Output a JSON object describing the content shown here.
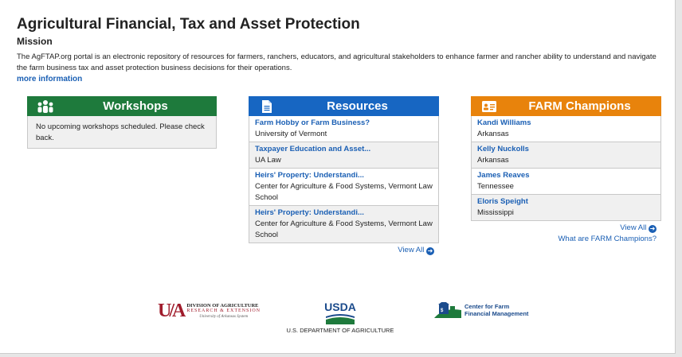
{
  "page": {
    "title": "Agricultural Financial, Tax and Asset Protection",
    "mission_heading": "Mission",
    "description": "The AgFTAP.org portal is an electronic repository of resources for farmers, ranchers, educators, and agricultural stakeholders to enhance farmer and rancher ability to understand and navigate the farm business tax and asset protection business decisions for their operations.",
    "more_link": "more information"
  },
  "workshops": {
    "title": "Workshops",
    "color": "#1e7a3c",
    "empty_message": "No upcoming workshops scheduled. Please check back."
  },
  "resources": {
    "title": "Resources",
    "color": "#1766c2",
    "items": [
      {
        "title": "Farm Hobby or Farm Business?",
        "source": "University of Vermont"
      },
      {
        "title": "Taxpayer Education and Asset...",
        "source": "UA Law"
      },
      {
        "title": "Heirs' Property: Understandi...",
        "source": "Center for Agriculture & Food Systems, Vermont Law School"
      },
      {
        "title": "Heirs' Property: Understandi...",
        "source": "Center for Agriculture & Food Systems, Vermont Law School"
      }
    ],
    "view_all": "View All"
  },
  "champions": {
    "title": "FARM Champions",
    "color": "#e8830c",
    "items": [
      {
        "name": "Kandi Williams",
        "state": "Arkansas"
      },
      {
        "name": "Kelly Nuckolls",
        "state": "Arkansas"
      },
      {
        "name": "James Reaves",
        "state": "Tennessee"
      },
      {
        "name": "Eloris Speight",
        "state": "Mississippi"
      }
    ],
    "view_all": "View All",
    "what_are": "What are FARM Champions?"
  },
  "footer": {
    "uada_line1": "DIVISION OF AGRICULTURE",
    "uada_line2": "RESEARCH & EXTENSION",
    "uada_line3": "University of Arkansas System",
    "usda_word": "USDA",
    "usda_caption": "U.S. DEPARTMENT OF AGRICULTURE",
    "cffm_line1": "Center for Farm",
    "cffm_line2": "Financial Management"
  }
}
